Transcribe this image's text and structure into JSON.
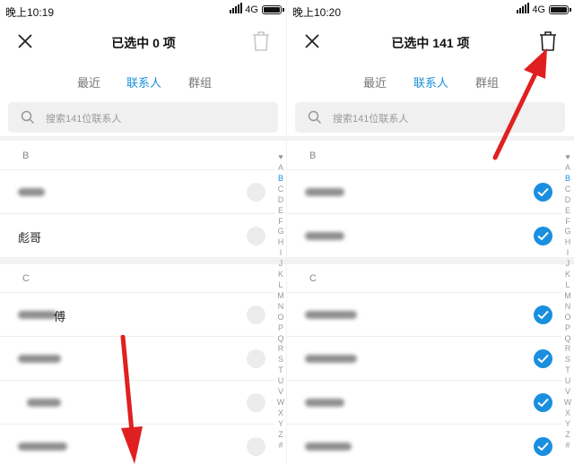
{
  "left": {
    "status": {
      "time": "晚上10:19",
      "network": "4G"
    },
    "title": "已选中  0  项",
    "tabs": [
      "最近",
      "联系人",
      "群组"
    ],
    "active_tab": 1,
    "search_placeholder": "搜索141位联系人",
    "sections": [
      {
        "letter": "B",
        "contacts": [
          {
            "name": "",
            "blurred": true,
            "checked": false
          },
          {
            "name": "彪哥",
            "blurred": false,
            "checked": false
          }
        ]
      },
      {
        "letter": "C",
        "contacts": [
          {
            "name": "傅",
            "blurred": true,
            "checked": false
          },
          {
            "name": "",
            "blurred": true,
            "checked": false
          },
          {
            "name": "",
            "blurred": true,
            "checked": false
          },
          {
            "name": "",
            "blurred": true,
            "checked": false
          }
        ]
      }
    ]
  },
  "right": {
    "status": {
      "time": "晚上10:20",
      "network": "4G"
    },
    "title": "已选中  141  项",
    "tabs": [
      "最近",
      "联系人",
      "群组"
    ],
    "active_tab": 1,
    "search_placeholder": "搜索141位联系人",
    "sections": [
      {
        "letter": "B",
        "contacts": [
          {
            "name": "",
            "blurred": true,
            "checked": true
          },
          {
            "name": "",
            "blurred": true,
            "checked": true
          }
        ]
      },
      {
        "letter": "C",
        "contacts": [
          {
            "name": "",
            "blurred": true,
            "checked": true
          },
          {
            "name": "",
            "blurred": true,
            "checked": true
          },
          {
            "name": "",
            "blurred": true,
            "checked": true
          },
          {
            "name": "",
            "blurred": true,
            "checked": true
          }
        ]
      }
    ]
  },
  "alphabet_index": [
    "A",
    "B",
    "C",
    "D",
    "E",
    "F",
    "G",
    "H",
    "I",
    "J",
    "K",
    "L",
    "M",
    "N",
    "O",
    "P",
    "Q",
    "R",
    "S",
    "T",
    "U",
    "V",
    "W",
    "X",
    "Y",
    "Z",
    "#"
  ],
  "alphabet_active": "B",
  "colors": {
    "accent": "#1a8fe0",
    "tab_active": "#1c8fd8",
    "arrow": "#e02020",
    "radio_empty": "#ececec"
  }
}
